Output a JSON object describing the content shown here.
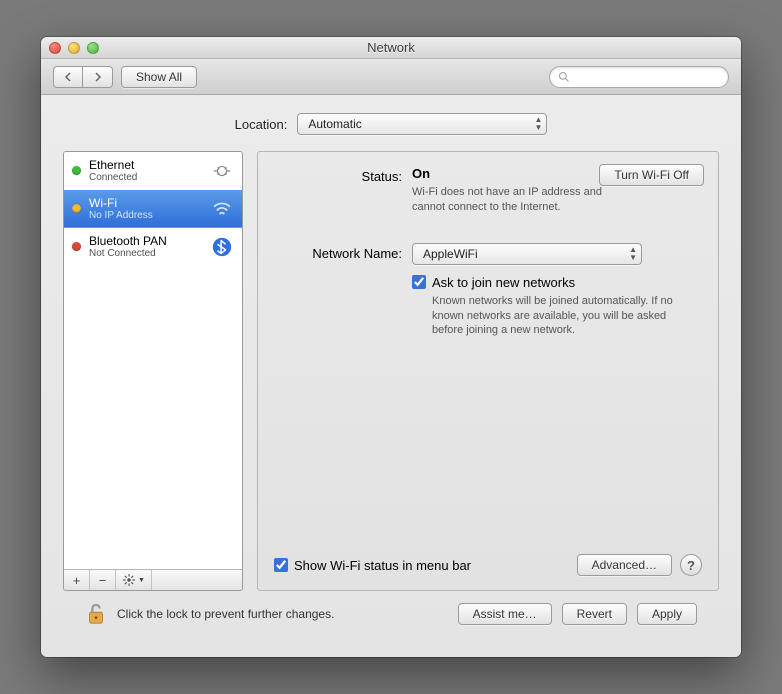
{
  "window": {
    "title": "Network"
  },
  "toolbar": {
    "show_all": "Show All",
    "search_placeholder": ""
  },
  "location": {
    "label": "Location:",
    "value": "Automatic"
  },
  "services": [
    {
      "name": "Ethernet",
      "status": "Connected",
      "dot_color": "#3bbf3b",
      "icon": "ethernet-icon",
      "selected": false
    },
    {
      "name": "Wi-Fi",
      "status": "No IP Address",
      "dot_color": "#f2b83a",
      "icon": "wifi-icon",
      "selected": true
    },
    {
      "name": "Bluetooth PAN",
      "status": "Not Connected",
      "dot_color": "#d84a3c",
      "icon": "bluetooth-icon",
      "selected": false
    }
  ],
  "sidebar_buttons": {
    "add": "+",
    "remove": "−",
    "gear": "✱▾"
  },
  "detail": {
    "status_label": "Status:",
    "status_value": "On",
    "turn_off": "Turn Wi-Fi Off",
    "status_desc": "Wi-Fi does not have an IP address and cannot connect to the Internet.",
    "netname_label": "Network Name:",
    "netname_value": "AppleWiFi",
    "ask_join": "Ask to join new networks",
    "ask_join_desc": "Known networks will be joined automatically. If no known networks are available, you will be asked before joining a new network.",
    "show_menu": "Show Wi-Fi status in menu bar",
    "advanced": "Advanced…"
  },
  "footer": {
    "lock_text": "Click the lock to prevent further changes.",
    "assist": "Assist me…",
    "revert": "Revert",
    "apply": "Apply"
  }
}
